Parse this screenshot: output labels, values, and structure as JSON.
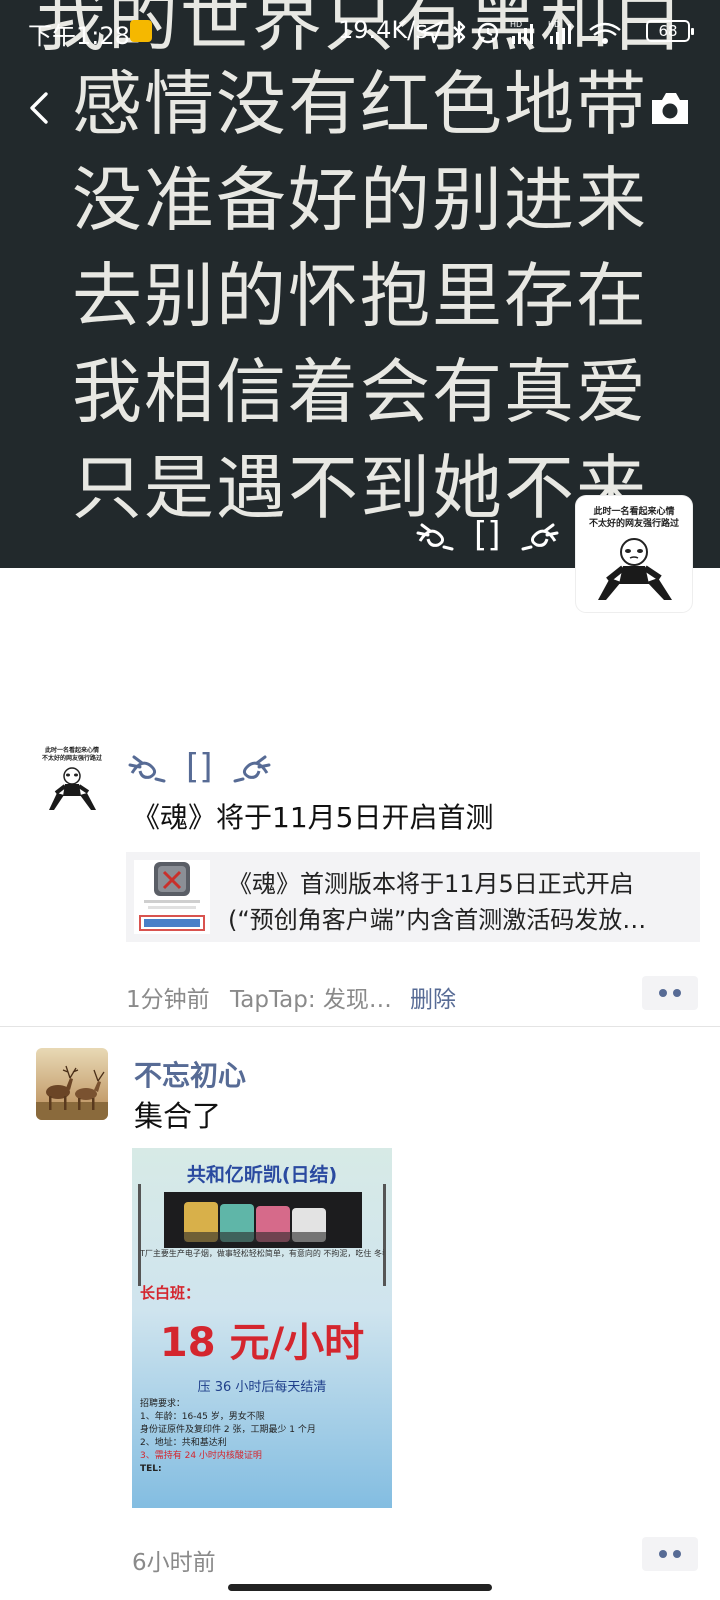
{
  "status_bar": {
    "time": "下午1:28",
    "net_speed": "19.4K/s",
    "battery": "68",
    "signal_labels": [
      "HD",
      "HD"
    ]
  },
  "cover": {
    "lines": [
      "我的世界只有黑和白",
      "感情没有红色地带",
      "没准备好的别进来",
      "去别的怀抱里存在",
      "我相信着会有真爱",
      "只是遇不到她不来"
    ],
    "back_icon": "chevron-left-icon",
    "camera_icon": "camera-icon"
  },
  "profile": {
    "name_bracket": "[]",
    "avatar_caption": [
      "此时一名看起来心情",
      "不太好的网友强行路过"
    ]
  },
  "posts": [
    {
      "name_bracket": "[]",
      "text": "《魂》将于11月5日开启首测",
      "link": {
        "title": "《魂》首测版本将于11月5日正式开启",
        "description": "(“预创角客户端”内含首测激活码发放…"
      },
      "time": "1分钟前",
      "source": "TapTap: 发现…",
      "delete": "删除"
    },
    {
      "name": "不忘初心",
      "text": "集合了",
      "poster": {
        "title": "共和亿昕凯(日结)",
        "small_text": "T厂主要生产电子烟，做事轻松轻松简单，有意向的 不拘泥，吃住 冬季免费宿舍等条件",
        "shift": "长白班：",
        "wage": "18 元/小时",
        "settle": "压 36 小时后每天结清",
        "requirements": [
          "招聘要求：",
          "1、年龄：16-45 岁，男女不限",
          "身份证原件及复印件 2 张，工期最少 1 个月",
          "2、地址：共和基达利",
          "3、需持有 24 小时内核酸证明",
          "TEL:"
        ]
      },
      "time": "6小时前"
    }
  ]
}
